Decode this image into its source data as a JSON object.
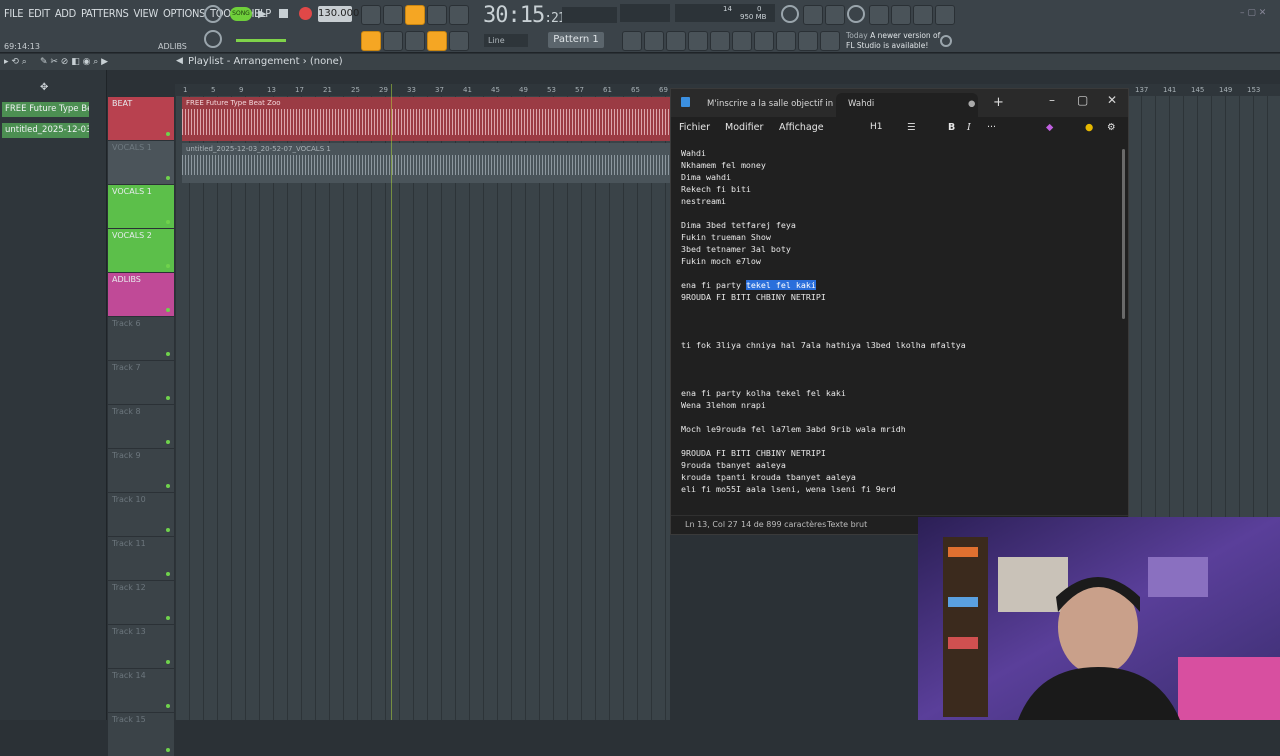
{
  "menu": [
    "FILE",
    "EDIT",
    "ADD",
    "PATTERNS",
    "VIEW",
    "OPTIONS",
    "TOOLS",
    "HELP"
  ],
  "transport": {
    "mode": "SONG",
    "tempo": "130.000",
    "clock_main": "30:15",
    "clock_small": ":21",
    "cpu_value": "14",
    "ram_value": "950 MB",
    "poly_value": "0"
  },
  "timecode": "69:14:13",
  "hint_label": "ADLIBS",
  "snap_label": "Line",
  "pattern_label": "Pattern 1",
  "news": {
    "line1": "Today",
    "line1b": "A newer version of",
    "line2": "FL Studio is available!"
  },
  "browser": {
    "items": [
      "FREE Future Type Be...",
      "untitled_2025-12-03 20..."
    ]
  },
  "playlist": {
    "title": "Playlist - Arrangement",
    "subtitle": "(none)"
  },
  "ruler": [
    "1",
    "5",
    "9",
    "13",
    "17",
    "21",
    "25",
    "29",
    "33",
    "37",
    "41",
    "45",
    "49",
    "53",
    "57",
    "61",
    "65",
    "69",
    "137",
    "141",
    "145",
    "149",
    "153"
  ],
  "tracks": [
    {
      "name": "BEAT",
      "color": "red"
    },
    {
      "name": "VOCALS 1",
      "color": "grey"
    },
    {
      "name": "VOCALS 1",
      "color": "green"
    },
    {
      "name": "VOCALS 2",
      "color": "green"
    },
    {
      "name": "ADLIBS",
      "color": "pink"
    },
    {
      "name": "Track 6",
      "color": "empty"
    },
    {
      "name": "Track 7",
      "color": "empty"
    },
    {
      "name": "Track 8",
      "color": "empty"
    },
    {
      "name": "Track 9",
      "color": "empty"
    },
    {
      "name": "Track 10",
      "color": "empty"
    },
    {
      "name": "Track 11",
      "color": "empty"
    },
    {
      "name": "Track 12",
      "color": "empty"
    },
    {
      "name": "Track 13",
      "color": "empty"
    },
    {
      "name": "Track 14",
      "color": "empty"
    },
    {
      "name": "Track 15",
      "color": "empty"
    }
  ],
  "clips": {
    "beat": "FREE Future Type Beat Zoo",
    "vocals": "untitled_2025-12-03_20-52-07_VOCALS 1"
  },
  "notepad": {
    "tab1": "M'inscrire a la salle objectif in",
    "tab2": "Wahdi",
    "menu": [
      "Fichier",
      "Modifier",
      "Affichage"
    ],
    "heading": "H1",
    "lines_before": "Wahdi\nNkhamem fel money\nDima wahdi\nRekech fi biti\nnestreami\n\nDima 3bed tetfarej feya\nFukin trueman Show\n3bed tetnamer 3al boty\nFukin moch e7low\n\n",
    "sel_prefix": "ena fi party ",
    "sel_text": "tekel fel kaki",
    "lines_after": "\n9ROUDA FI BITI CHBINY NETRIPI\n\n\n\nti fok 3liya chniya hal 7ala hathiya l3bed lkolha mfaltya\n\n\n\nena fi party kolha tekel fel kaki\nWena 3lehom nrapi\n\nMoch le9rouda fel la7lem 3abd 9rib wala mridh\n\n9ROUDA FI BITI CHBINY NETRIPI\n9rouda tbanyet aaleya\nkrouda tpanti krouda tbanyet aaleya\neli fi mo55I aala lseni, wena lseni fi 9erd",
    "status": {
      "pos": "Ln 13, Col 27",
      "count": "14 de 899 caractères",
      "format": "Texte brut"
    }
  }
}
